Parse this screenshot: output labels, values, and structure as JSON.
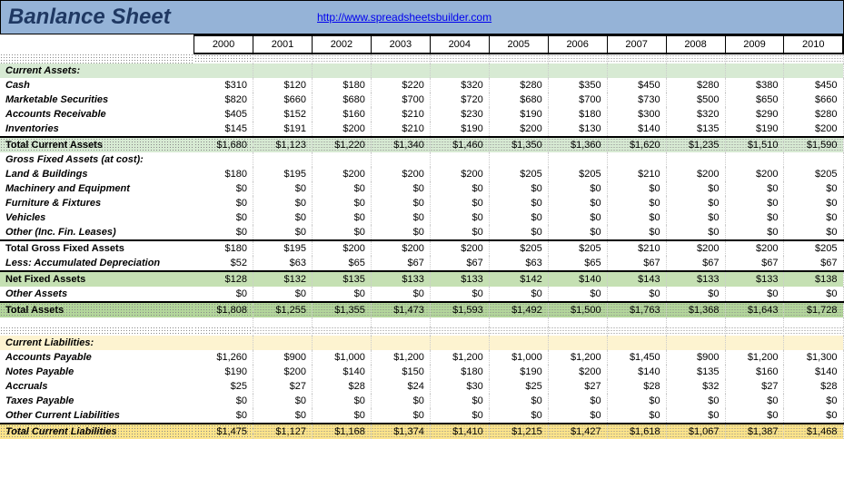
{
  "header": {
    "title": "Banlance Sheet",
    "link": "http://www.spreadsheetsbuilder.com"
  },
  "years": [
    "2000",
    "2001",
    "2002",
    "2003",
    "2004",
    "2005",
    "2006",
    "2007",
    "2008",
    "2009",
    "2010"
  ],
  "sections": {
    "ca_title": "Current Assets:",
    "gfa_title": "Gross Fixed Assets (at cost):",
    "cl_title": "Current Liabilities:"
  },
  "rows": {
    "cash": {
      "label": "Cash",
      "v": [
        "$310",
        "$120",
        "$180",
        "$220",
        "$320",
        "$280",
        "$350",
        "$450",
        "$280",
        "$380",
        "$450"
      ]
    },
    "msec": {
      "label": "Marketable Securities",
      "v": [
        "$820",
        "$660",
        "$680",
        "$700",
        "$720",
        "$680",
        "$700",
        "$730",
        "$500",
        "$650",
        "$660"
      ]
    },
    "ar": {
      "label": "Accounts Receivable",
      "v": [
        "$405",
        "$152",
        "$160",
        "$210",
        "$230",
        "$190",
        "$180",
        "$300",
        "$320",
        "$290",
        "$280"
      ]
    },
    "inv": {
      "label": "Inventories",
      "v": [
        "$145",
        "$191",
        "$200",
        "$210",
        "$190",
        "$200",
        "$130",
        "$140",
        "$135",
        "$190",
        "$200"
      ]
    },
    "tca": {
      "label": "Total Current Assets",
      "v": [
        "$1,680",
        "$1,123",
        "$1,220",
        "$1,340",
        "$1,460",
        "$1,350",
        "$1,360",
        "$1,620",
        "$1,235",
        "$1,510",
        "$1,590"
      ]
    },
    "land": {
      "label": "Land & Buildings",
      "v": [
        "$180",
        "$195",
        "$200",
        "$200",
        "$200",
        "$205",
        "$205",
        "$210",
        "$200",
        "$200",
        "$205"
      ]
    },
    "mach": {
      "label": "Machinery and Equipment",
      "v": [
        "$0",
        "$0",
        "$0",
        "$0",
        "$0",
        "$0",
        "$0",
        "$0",
        "$0",
        "$0",
        "$0"
      ]
    },
    "furn": {
      "label": "Furniture & Fixtures",
      "v": [
        "$0",
        "$0",
        "$0",
        "$0",
        "$0",
        "$0",
        "$0",
        "$0",
        "$0",
        "$0",
        "$0"
      ]
    },
    "veh": {
      "label": "Vehicles",
      "v": [
        "$0",
        "$0",
        "$0",
        "$0",
        "$0",
        "$0",
        "$0",
        "$0",
        "$0",
        "$0",
        "$0"
      ]
    },
    "other_lease": {
      "label": "Other (Inc. Fin. Leases)",
      "v": [
        "$0",
        "$0",
        "$0",
        "$0",
        "$0",
        "$0",
        "$0",
        "$0",
        "$0",
        "$0",
        "$0"
      ]
    },
    "tgfa": {
      "label": "Total Gross Fixed Assets",
      "v": [
        "$180",
        "$195",
        "$200",
        "$200",
        "$200",
        "$205",
        "$205",
        "$210",
        "$200",
        "$200",
        "$205"
      ]
    },
    "dep": {
      "label": "Less:  Accumulated Depreciation",
      "v": [
        "$52",
        "$63",
        "$65",
        "$67",
        "$67",
        "$63",
        "$65",
        "$67",
        "$67",
        "$67",
        "$67"
      ]
    },
    "nfa": {
      "label": "Net Fixed Assets",
      "v": [
        "$128",
        "$132",
        "$135",
        "$133",
        "$133",
        "$142",
        "$140",
        "$143",
        "$133",
        "$133",
        "$138"
      ]
    },
    "oassets": {
      "label": "Other Assets",
      "v": [
        "$0",
        "$0",
        "$0",
        "$0",
        "$0",
        "$0",
        "$0",
        "$0",
        "$0",
        "$0",
        "$0"
      ]
    },
    "ta": {
      "label": "Total Assets",
      "v": [
        "$1,808",
        "$1,255",
        "$1,355",
        "$1,473",
        "$1,593",
        "$1,492",
        "$1,500",
        "$1,763",
        "$1,368",
        "$1,643",
        "$1,728"
      ]
    },
    "ap": {
      "label": "Accounts Payable",
      "v": [
        "$1,260",
        "$900",
        "$1,000",
        "$1,200",
        "$1,200",
        "$1,000",
        "$1,200",
        "$1,450",
        "$900",
        "$1,200",
        "$1,300"
      ]
    },
    "np": {
      "label": "Notes Payable",
      "v": [
        "$190",
        "$200",
        "$140",
        "$150",
        "$180",
        "$190",
        "$200",
        "$140",
        "$135",
        "$160",
        "$140"
      ]
    },
    "accr": {
      "label": "Accruals",
      "v": [
        "$25",
        "$27",
        "$28",
        "$24",
        "$30",
        "$25",
        "$27",
        "$28",
        "$32",
        "$27",
        "$28"
      ]
    },
    "tax": {
      "label": "Taxes Payable",
      "v": [
        "$0",
        "$0",
        "$0",
        "$0",
        "$0",
        "$0",
        "$0",
        "$0",
        "$0",
        "$0",
        "$0"
      ]
    },
    "ocl": {
      "label": "Other Current Liabilities",
      "v": [
        "$0",
        "$0",
        "$0",
        "$0",
        "$0",
        "$0",
        "$0",
        "$0",
        "$0",
        "$0",
        "$0"
      ]
    },
    "tcl": {
      "label": "Total Current Liabilities",
      "v": [
        "$1,475",
        "$1,127",
        "$1,168",
        "$1,374",
        "$1,410",
        "$1,215",
        "$1,427",
        "$1,618",
        "$1,067",
        "$1,387",
        "$1,468"
      ]
    }
  },
  "chart_data": {
    "type": "table",
    "title": "Banlance Sheet",
    "categories": [
      "2000",
      "2001",
      "2002",
      "2003",
      "2004",
      "2005",
      "2006",
      "2007",
      "2008",
      "2009",
      "2010"
    ],
    "series": [
      {
        "name": "Cash",
        "values": [
          310,
          120,
          180,
          220,
          320,
          280,
          350,
          450,
          280,
          380,
          450
        ]
      },
      {
        "name": "Marketable Securities",
        "values": [
          820,
          660,
          680,
          700,
          720,
          680,
          700,
          730,
          500,
          650,
          660
        ]
      },
      {
        "name": "Accounts Receivable",
        "values": [
          405,
          152,
          160,
          210,
          230,
          190,
          180,
          300,
          320,
          290,
          280
        ]
      },
      {
        "name": "Inventories",
        "values": [
          145,
          191,
          200,
          210,
          190,
          200,
          130,
          140,
          135,
          190,
          200
        ]
      },
      {
        "name": "Total Current Assets",
        "values": [
          1680,
          1123,
          1220,
          1340,
          1460,
          1350,
          1360,
          1620,
          1235,
          1510,
          1590
        ]
      },
      {
        "name": "Land & Buildings",
        "values": [
          180,
          195,
          200,
          200,
          200,
          205,
          205,
          210,
          200,
          200,
          205
        ]
      },
      {
        "name": "Machinery and Equipment",
        "values": [
          0,
          0,
          0,
          0,
          0,
          0,
          0,
          0,
          0,
          0,
          0
        ]
      },
      {
        "name": "Furniture & Fixtures",
        "values": [
          0,
          0,
          0,
          0,
          0,
          0,
          0,
          0,
          0,
          0,
          0
        ]
      },
      {
        "name": "Vehicles",
        "values": [
          0,
          0,
          0,
          0,
          0,
          0,
          0,
          0,
          0,
          0,
          0
        ]
      },
      {
        "name": "Other (Inc. Fin. Leases)",
        "values": [
          0,
          0,
          0,
          0,
          0,
          0,
          0,
          0,
          0,
          0,
          0
        ]
      },
      {
        "name": "Total Gross Fixed Assets",
        "values": [
          180,
          195,
          200,
          200,
          200,
          205,
          205,
          210,
          200,
          200,
          205
        ]
      },
      {
        "name": "Less: Accumulated Depreciation",
        "values": [
          52,
          63,
          65,
          67,
          67,
          63,
          65,
          67,
          67,
          67,
          67
        ]
      },
      {
        "name": "Net Fixed Assets",
        "values": [
          128,
          132,
          135,
          133,
          133,
          142,
          140,
          143,
          133,
          133,
          138
        ]
      },
      {
        "name": "Other Assets",
        "values": [
          0,
          0,
          0,
          0,
          0,
          0,
          0,
          0,
          0,
          0,
          0
        ]
      },
      {
        "name": "Total Assets",
        "values": [
          1808,
          1255,
          1355,
          1473,
          1593,
          1492,
          1500,
          1763,
          1368,
          1643,
          1728
        ]
      },
      {
        "name": "Accounts Payable",
        "values": [
          1260,
          900,
          1000,
          1200,
          1200,
          1000,
          1200,
          1450,
          900,
          1200,
          1300
        ]
      },
      {
        "name": "Notes Payable",
        "values": [
          190,
          200,
          140,
          150,
          180,
          190,
          200,
          140,
          135,
          160,
          140
        ]
      },
      {
        "name": "Accruals",
        "values": [
          25,
          27,
          28,
          24,
          30,
          25,
          27,
          28,
          32,
          27,
          28
        ]
      },
      {
        "name": "Taxes Payable",
        "values": [
          0,
          0,
          0,
          0,
          0,
          0,
          0,
          0,
          0,
          0,
          0
        ]
      },
      {
        "name": "Other Current Liabilities",
        "values": [
          0,
          0,
          0,
          0,
          0,
          0,
          0,
          0,
          0,
          0,
          0
        ]
      },
      {
        "name": "Total Current Liabilities",
        "values": [
          1475,
          1127,
          1168,
          1374,
          1410,
          1215,
          1427,
          1618,
          1067,
          1387,
          1468
        ]
      }
    ]
  }
}
